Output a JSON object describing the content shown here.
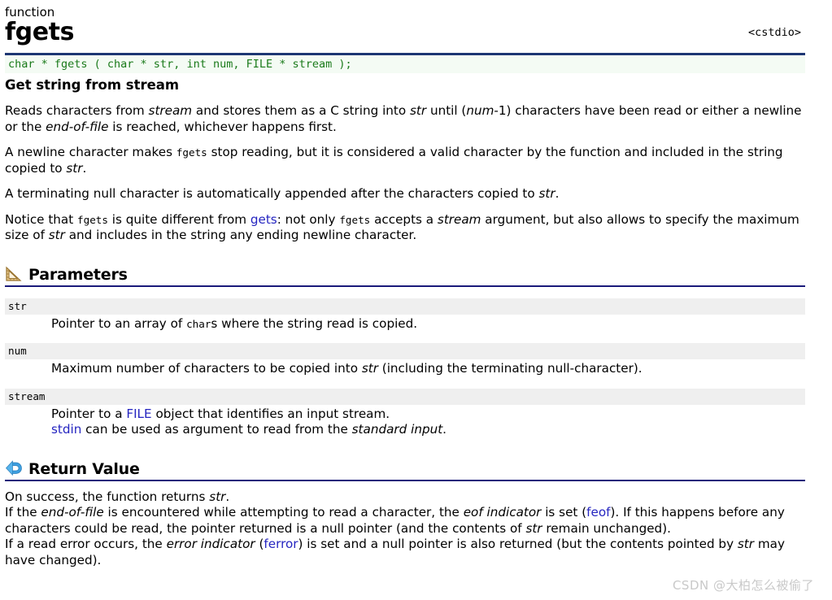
{
  "header": {
    "kind": "function",
    "name": "fgets",
    "include_file": "<cstdio>",
    "signature": "char * fgets ( char * str, int num, FILE * stream );",
    "subtitle": "Get string from stream"
  },
  "description": {
    "paragraph1": {
      "t1": "Reads characters from ",
      "em1": "stream",
      "t2": " and stores them as a C string into ",
      "em2": "str",
      "t3": " until (",
      "em3": "num",
      "t4": "-1) characters have been read or either a newline or the ",
      "em4": "end-of-file",
      "t5": " is reached, whichever happens first."
    },
    "paragraph2": {
      "t1": "A newline character makes ",
      "code1": "fgets",
      "t2": " stop reading, but it is considered a valid character by the function and included in the string copied to ",
      "em1": "str",
      "t3": "."
    },
    "paragraph3": {
      "t1": "A terminating null character is automatically appended after the characters copied to ",
      "em1": "str",
      "t2": "."
    },
    "paragraph4": {
      "t1": "Notice that ",
      "code1": "fgets",
      "t2": " is quite different from ",
      "link1": "gets",
      "t3": ": not only ",
      "code2": "fgets",
      "t4": " accepts a ",
      "em1": "stream",
      "t5": " argument, but also allows to specify the maximum size of ",
      "em2": "str",
      "t6": " and includes in the string any ending newline character."
    }
  },
  "parameters_section": {
    "title": "Parameters",
    "icon": "triangle-ruler-icon",
    "items": [
      {
        "name": "str",
        "desc": {
          "t1": "Pointer to an array of ",
          "code1": "char",
          "t2": "s where the string read is copied."
        }
      },
      {
        "name": "num",
        "desc": {
          "t1": "Maximum number of characters to be copied into ",
          "em1": "str",
          "t2": " (including the terminating null-character)."
        }
      },
      {
        "name": "stream",
        "desc": {
          "t1": "Pointer to a ",
          "link1": "FILE",
          "t2": " object that identifies an input stream.",
          "link2": "stdin",
          "t3": " can be used as argument to read from the ",
          "em1": "standard input",
          "t4": "."
        }
      }
    ]
  },
  "return_section": {
    "title": "Return Value",
    "icon": "return-arrow-icon",
    "body": {
      "l1_t1": "On success, the function returns ",
      "l1_em1": "str",
      "l1_t2": ".",
      "l2_t1": "If the ",
      "l2_em1": "end-of-file",
      "l2_t2": " is encountered while attempting to read a character, the ",
      "l2_em2": "eof indicator",
      "l2_t3": " is set (",
      "l2_link1": "feof",
      "l2_t4": "). If this happens before any characters could be read, the pointer returned is a null pointer (and the contents of ",
      "l2_em3": "str",
      "l2_t5": " remain unchanged).",
      "l3_t1": "If a read error occurs, the ",
      "l3_em1": "error indicator",
      "l3_t2": " (",
      "l3_link1": "ferror",
      "l3_t3": ") is set and a null pointer is also returned (but the contents pointed by ",
      "l3_em2": "str",
      "l3_t4": " may have changed)."
    }
  },
  "watermark": "CSDN @大柏怎么被偷了",
  "colors": {
    "signature_text": "#1a7a1a",
    "signature_border": "#1d3673",
    "link": "#2525c0",
    "section_rule": "#1a1a7a",
    "param_band": "#efefef",
    "watermark": "#c9c9c9"
  }
}
